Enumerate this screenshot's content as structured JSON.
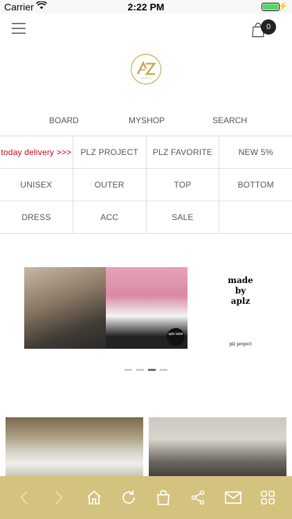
{
  "status_bar": {
    "carrier": "Carrier",
    "time": "2:22 PM"
  },
  "cart": {
    "count": "0"
  },
  "top_nav": [
    "BOARD",
    "MYSHOP",
    "SEARCH"
  ],
  "categories": [
    [
      {
        "label": "today delivery >>>",
        "highlight": true
      },
      {
        "label": "PLZ PROJECT"
      },
      {
        "label": "PLZ FAVORITE"
      },
      {
        "label": "NEW 5%"
      }
    ],
    [
      {
        "label": "UNISEX"
      },
      {
        "label": "OUTER"
      },
      {
        "label": "TOP"
      },
      {
        "label": "BOTTOM"
      }
    ],
    [
      {
        "label": "DRESS"
      },
      {
        "label": "ACC"
      },
      {
        "label": "SALE"
      },
      {
        "label": ""
      }
    ]
  ],
  "banner": {
    "badge_text": "aplz label",
    "side_text_lines": [
      "made",
      "by",
      "aplz"
    ],
    "side_caption": "plz project",
    "dot_count": 4,
    "active_dot": 2
  },
  "colors": {
    "toolbar": "#d4c37e",
    "toolbar_icons": "#ffffff",
    "delivery_text": "#d0021b",
    "logo_gold": "#c9a94a"
  },
  "toolbar_icons": [
    "back-arrow-icon",
    "forward-arrow-icon",
    "home-icon",
    "refresh-icon",
    "shopping-bag-icon",
    "share-icon",
    "mail-icon",
    "grid-icon"
  ]
}
